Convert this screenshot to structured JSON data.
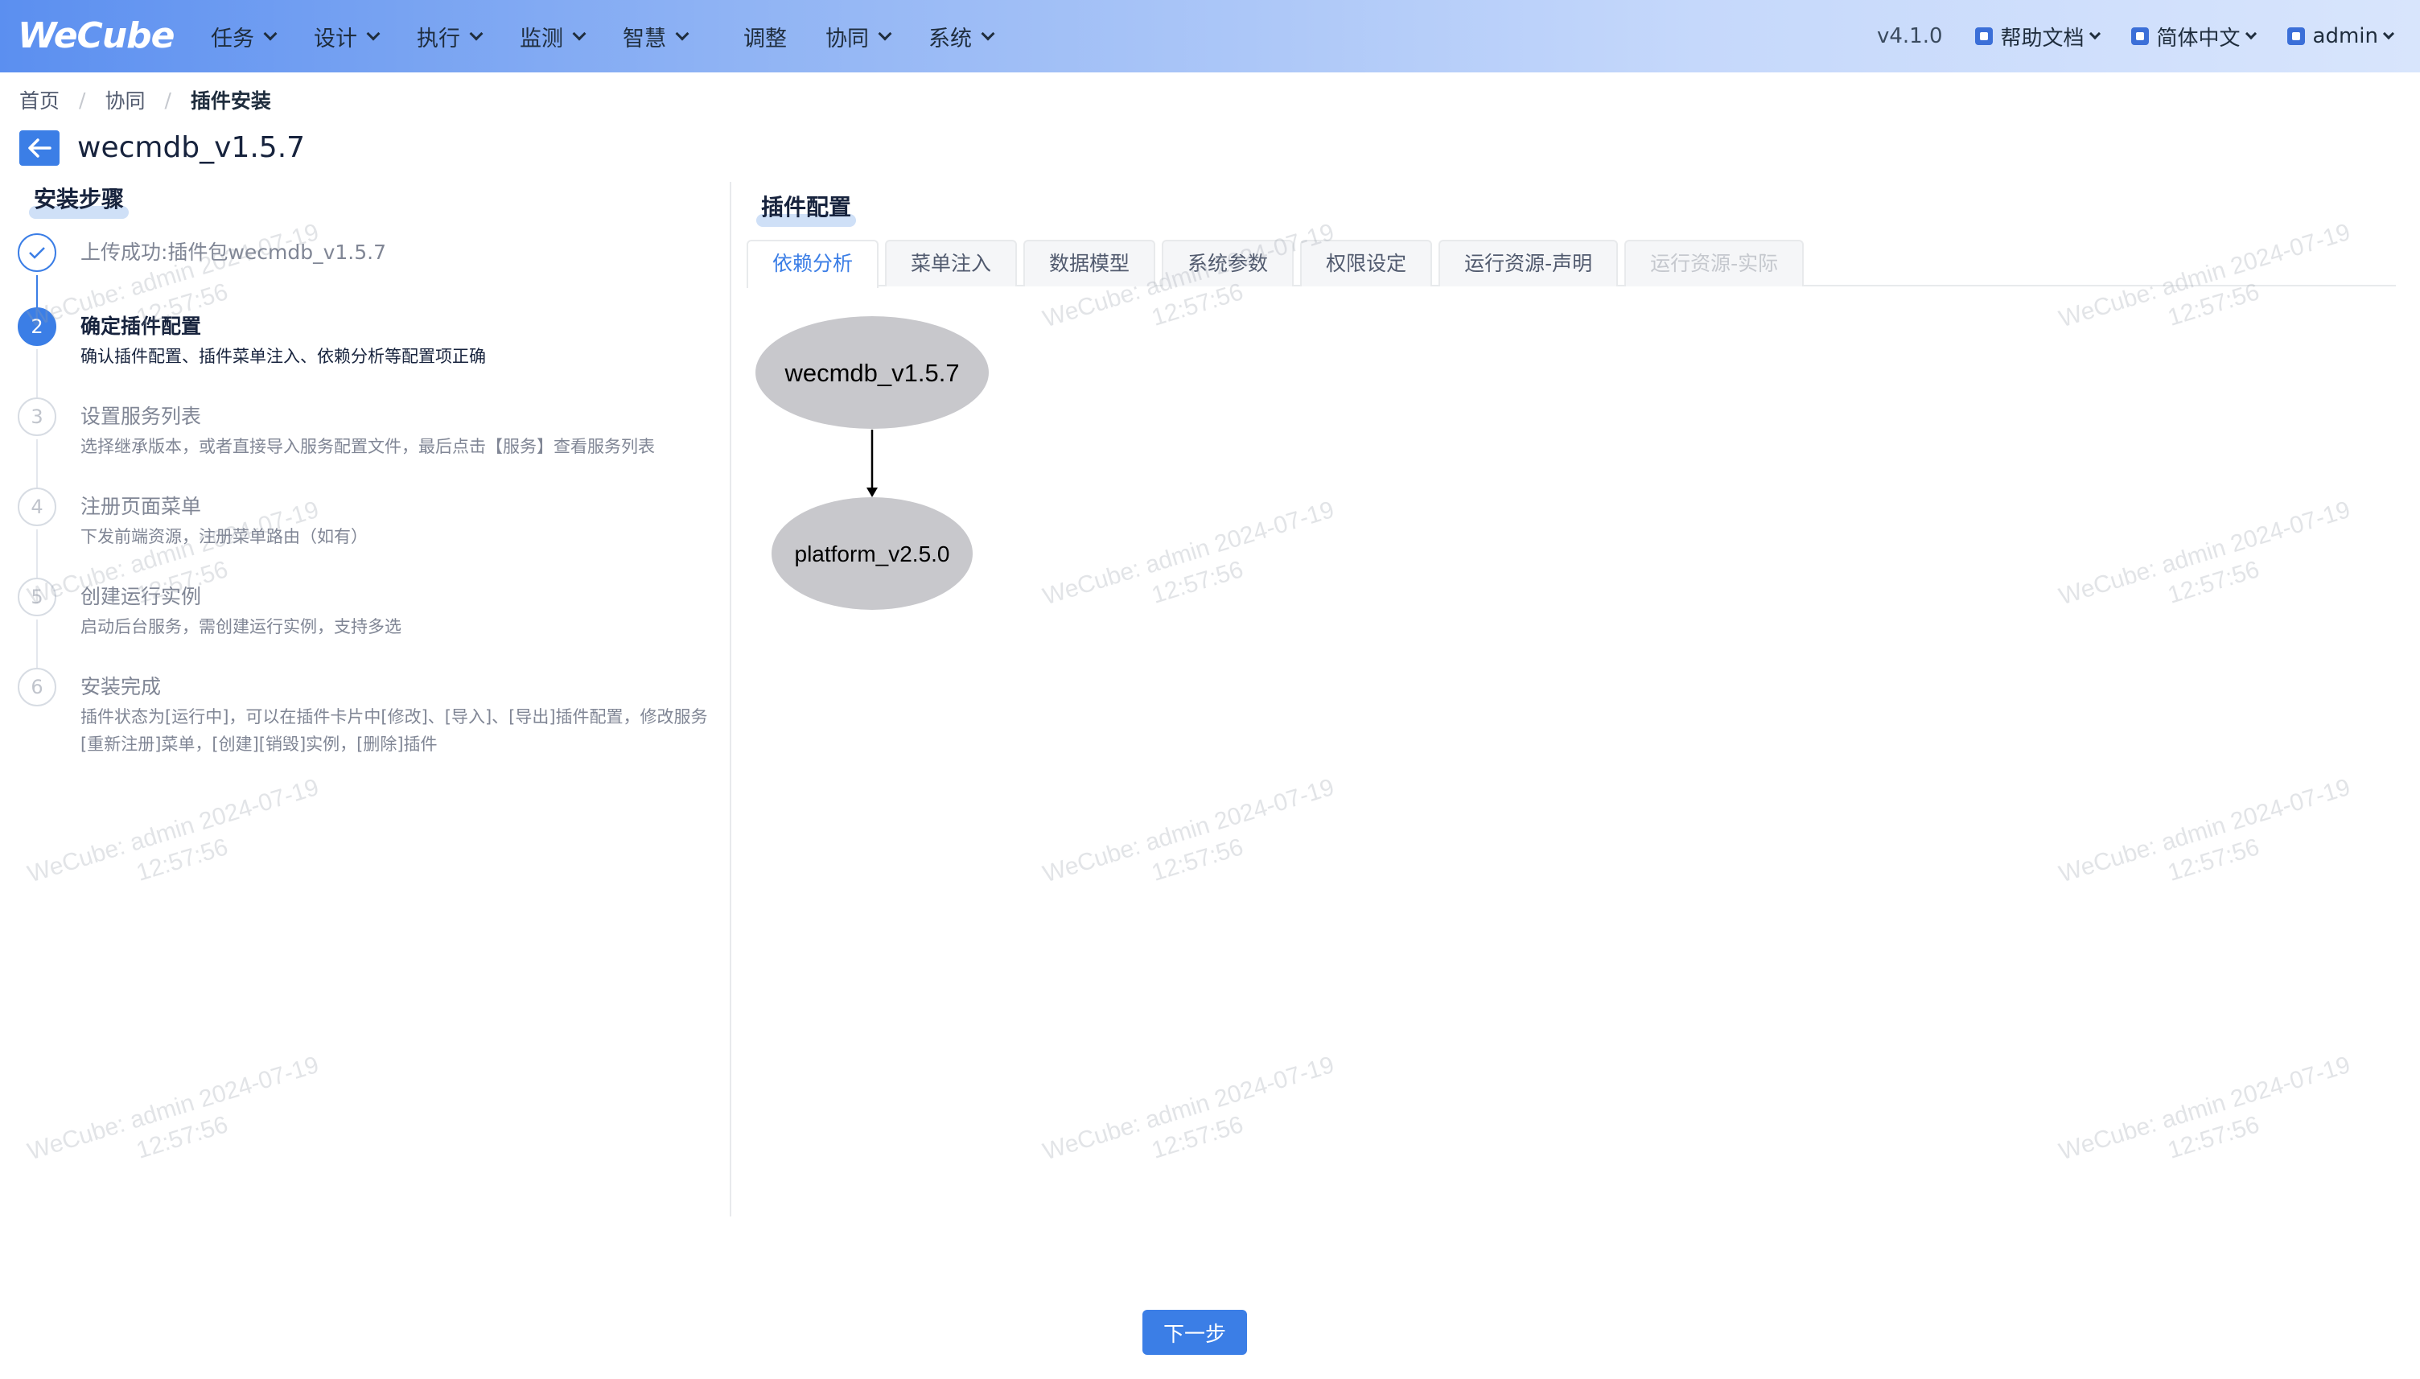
{
  "header": {
    "logo_text": "WeCube",
    "nav": [
      {
        "label": "任务",
        "has_dropdown": true
      },
      {
        "label": "设计",
        "has_dropdown": true
      },
      {
        "label": "执行",
        "has_dropdown": true
      },
      {
        "label": "监测",
        "has_dropdown": true
      },
      {
        "label": "智慧",
        "has_dropdown": true
      },
      {
        "label": "调整",
        "has_dropdown": false
      },
      {
        "label": "协同",
        "has_dropdown": true
      },
      {
        "label": "系统",
        "has_dropdown": true
      }
    ],
    "version": "v4.1.0",
    "help_docs": "帮助文档",
    "language": "简体中文",
    "user": "admin"
  },
  "breadcrumb": {
    "home": "首页",
    "parent": "协同",
    "current": "插件安装"
  },
  "page": {
    "title": "wecmdb_v1.5.7"
  },
  "install_steps": {
    "title": "安装步骤",
    "steps": [
      {
        "number": "1",
        "status": "done",
        "title": "上传成功:插件包wecmdb_v1.5.7",
        "desc": ""
      },
      {
        "number": "2",
        "status": "active",
        "title": "确定插件配置",
        "desc": "确认插件配置、插件菜单注入、依赖分析等配置项正确"
      },
      {
        "number": "3",
        "status": "wait",
        "title": "设置服务列表",
        "desc": "选择继承版本，或者直接导入服务配置文件，最后点击【服务】查看服务列表"
      },
      {
        "number": "4",
        "status": "wait",
        "title": "注册页面菜单",
        "desc": "下发前端资源，注册菜单路由（如有）"
      },
      {
        "number": "5",
        "status": "wait",
        "title": "创建运行实例",
        "desc": "启动后台服务，需创建运行实例，支持多选"
      },
      {
        "number": "6",
        "status": "wait",
        "title": "安装完成",
        "desc": "插件状态为[运行中]，可以在插件卡片中[修改]、[导入]、[导出]插件配置，修改服务[重新注册]菜单，[创建][销毁]实例，[删除]插件"
      }
    ]
  },
  "plugin_config": {
    "title": "插件配置",
    "tabs": [
      {
        "label": "依赖分析",
        "state": "active"
      },
      {
        "label": "菜单注入",
        "state": "normal"
      },
      {
        "label": "数据模型",
        "state": "normal"
      },
      {
        "label": "系统参数",
        "state": "normal"
      },
      {
        "label": "权限设定",
        "state": "normal"
      },
      {
        "label": "运行资源-声明",
        "state": "normal"
      },
      {
        "label": "运行资源-实际",
        "state": "disabled"
      }
    ],
    "dependency_graph": {
      "nodes": [
        {
          "id": "wecmdb",
          "label": "wecmdb_v1.5.7"
        },
        {
          "id": "platform",
          "label": "platform_v2.5.0"
        }
      ],
      "edges": [
        {
          "from": "wecmdb",
          "to": "platform"
        }
      ]
    }
  },
  "watermark": {
    "line1": "WeCube: admin 2024-07-19",
    "line2": "12:57:56"
  },
  "footer": {
    "next_button": "下一步"
  },
  "colors": {
    "primary": "#3b7ee6",
    "node_fill": "#c8c8cc",
    "header_gradient_start": "#5b8ff0",
    "header_gradient_end": "#d8e5fc"
  }
}
